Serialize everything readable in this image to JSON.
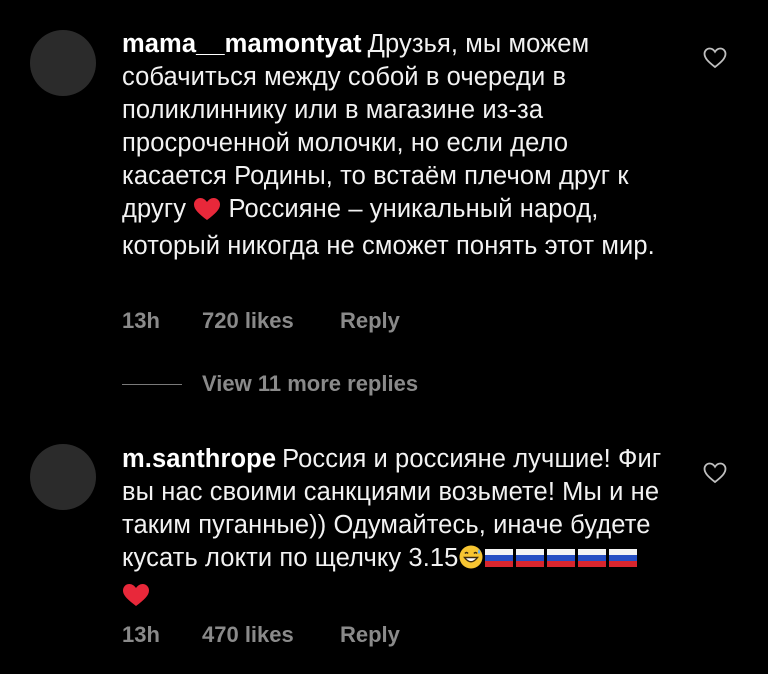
{
  "comments": [
    {
      "username": "mama__mamontyat",
      "text_part1": "Друзья, мы можем собачиться между собой в очереди в поликлиннику или в магазине из-за просроченной молочки, но если дело касается Родины, то встаём плечом друг к другу",
      "text_part2": " Россияне – уникальный народ, который никогда не сможет понять этот мир.",
      "emoji": "heart-icon",
      "time": "13h",
      "likes": "720 likes",
      "reply_label": "Reply"
    },
    {
      "username": "m.santhrope",
      "text": "Россия и россияне лучшие! Фиг вы нас своими санкциями возьмете! Мы и не таким пуганные)) Одумайтесь, иначе будете кусать локти по щелчку 3.15",
      "trailing_emojis": [
        "grinning-sweat-icon",
        "russia-flag-icon",
        "russia-flag-icon",
        "russia-flag-icon",
        "russia-flag-icon",
        "russia-flag-icon",
        "heart-icon"
      ],
      "time": "13h",
      "likes": "470 likes",
      "reply_label": "Reply"
    }
  ],
  "view_more_replies": "View 11 more replies",
  "colors": {
    "background": "#000000",
    "text": "#f2f2f2",
    "muted": "#8a8a8a",
    "heart_red": "#e8283a"
  }
}
